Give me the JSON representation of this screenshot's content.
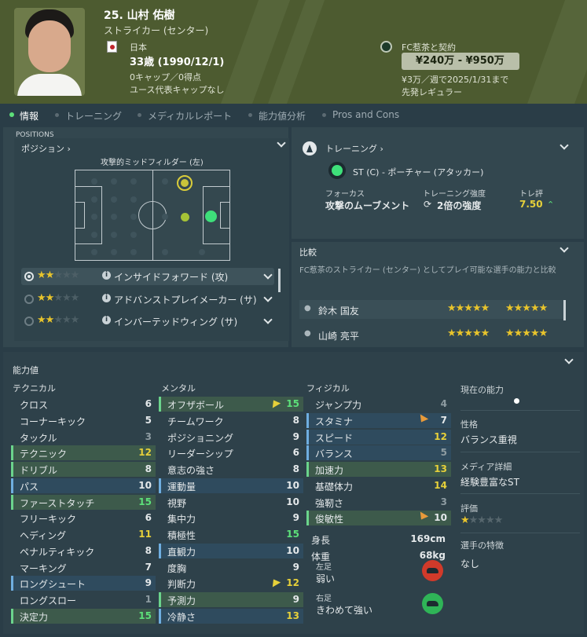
{
  "header": {
    "name": "25. 山村 佑樹",
    "position": "ストライカー (センター)",
    "nation": "日本",
    "age": "33歳 (1990/12/1)",
    "caps": "0キャップ／0得点",
    "youth_caps": "ユース代表キャップなし",
    "club_contract": "FC惹茶と契約",
    "value_range": "¥240万 - ¥950万",
    "wage": "¥3万／週で2025/1/31まで",
    "squad_status": "先発レギュラー"
  },
  "tabs": [
    "情報",
    "トレーニング",
    "メディカルレポート",
    "能力値分析",
    "Pros and Cons"
  ],
  "positions": {
    "section": "POSITIONS",
    "title": "ポジション",
    "pitch_label": "攻撃的ミッドフィルダー (左)",
    "roles": [
      {
        "label": "インサイドフォワード (攻)",
        "stars": 2,
        "selected": true
      },
      {
        "label": "アドバンストプレイメーカー (サ)",
        "stars": 2,
        "selected": false
      },
      {
        "label": "インバーテッドウィング (サ)",
        "stars": 2,
        "selected": false
      }
    ]
  },
  "training": {
    "title": "トレーニング",
    "role": "ST (C) - ポーチャー (アタッカー)",
    "focus_label": "フォーカス",
    "focus": "攻撃のムーブメント",
    "intensity_label": "トレーニング強度",
    "intensity": "2倍の強度",
    "rating_label": "トレ評",
    "rating": "7.50"
  },
  "comparison": {
    "title": "比較",
    "desc": "FC惹茶のストライカー (センター) としてプレイ可能な選手の能力と比較",
    "players": [
      {
        "name": "鈴木 国友",
        "cur_stars": 4.5,
        "pot_stars": 4.5
      },
      {
        "name": "山崎 亮平",
        "cur_stars": 4.5,
        "pot_stars": 4.5
      }
    ]
  },
  "attributes": {
    "title": "能力値",
    "technical_title": "テクニカル",
    "mental_title": "メンタル",
    "physical_title": "フィジカル",
    "technical": [
      {
        "n": "クロス",
        "v": "6",
        "c": "w",
        "h": ""
      },
      {
        "n": "コーナーキック",
        "v": "5",
        "c": "w",
        "h": ""
      },
      {
        "n": "タックル",
        "v": "3",
        "c": "d",
        "h": ""
      },
      {
        "n": "テクニック",
        "v": "12",
        "c": "y",
        "h": "g"
      },
      {
        "n": "ドリブル",
        "v": "8",
        "c": "w",
        "h": "g"
      },
      {
        "n": "パス",
        "v": "10",
        "c": "w",
        "h": "b"
      },
      {
        "n": "ファーストタッチ",
        "v": "15",
        "c": "g",
        "h": "g"
      },
      {
        "n": "フリーキック",
        "v": "6",
        "c": "w",
        "h": ""
      },
      {
        "n": "ヘディング",
        "v": "11",
        "c": "y",
        "h": ""
      },
      {
        "n": "ペナルティキック",
        "v": "8",
        "c": "w",
        "h": ""
      },
      {
        "n": "マーキング",
        "v": "7",
        "c": "w",
        "h": ""
      },
      {
        "n": "ロングシュート",
        "v": "9",
        "c": "w",
        "h": "b"
      },
      {
        "n": "ロングスロー",
        "v": "1",
        "c": "d",
        "h": ""
      },
      {
        "n": "決定力",
        "v": "15",
        "c": "g",
        "h": "g"
      }
    ],
    "mental": [
      {
        "n": "オフザボール",
        "v": "15",
        "c": "g",
        "h": "g",
        "a": "up"
      },
      {
        "n": "チームワーク",
        "v": "8",
        "c": "w",
        "h": ""
      },
      {
        "n": "ポジショニング",
        "v": "9",
        "c": "w",
        "h": ""
      },
      {
        "n": "リーダーシップ",
        "v": "6",
        "c": "w",
        "h": ""
      },
      {
        "n": "意志の強さ",
        "v": "8",
        "c": "w",
        "h": ""
      },
      {
        "n": "運動量",
        "v": "10",
        "c": "w",
        "h": "b"
      },
      {
        "n": "視野",
        "v": "10",
        "c": "w",
        "h": ""
      },
      {
        "n": "集中力",
        "v": "9",
        "c": "w",
        "h": ""
      },
      {
        "n": "積極性",
        "v": "15",
        "c": "g",
        "h": ""
      },
      {
        "n": "直観力",
        "v": "10",
        "c": "w",
        "h": "b"
      },
      {
        "n": "度胸",
        "v": "9",
        "c": "w",
        "h": ""
      },
      {
        "n": "判断力",
        "v": "12",
        "c": "y",
        "h": "",
        "a": "up"
      },
      {
        "n": "予測力",
        "v": "9",
        "c": "w",
        "h": "g"
      },
      {
        "n": "冷静さ",
        "v": "13",
        "c": "y",
        "h": "b"
      }
    ],
    "physical": [
      {
        "n": "ジャンプ力",
        "v": "4",
        "c": "d",
        "h": ""
      },
      {
        "n": "スタミナ",
        "v": "7",
        "c": "w",
        "h": "b",
        "a": "down"
      },
      {
        "n": "スピード",
        "v": "12",
        "c": "y",
        "h": "b"
      },
      {
        "n": "バランス",
        "v": "5",
        "c": "d",
        "h": "b"
      },
      {
        "n": "加速力",
        "v": "13",
        "c": "y",
        "h": "g"
      },
      {
        "n": "基礎体力",
        "v": "14",
        "c": "y",
        "h": ""
      },
      {
        "n": "強靭さ",
        "v": "3",
        "c": "d",
        "h": ""
      },
      {
        "n": "俊敏性",
        "v": "10",
        "c": "w",
        "h": "g",
        "a": "down"
      }
    ],
    "height_label": "身長",
    "height": "169cm",
    "weight_label": "体重",
    "weight": "68kg",
    "left_foot_label": "左足",
    "left_foot": "弱い",
    "right_foot_label": "右足",
    "right_foot": "きわめて強い"
  },
  "side": {
    "current_ability": "現在の能力",
    "personality_label": "性格",
    "personality": "バランス重視",
    "media_label": "メディア詳細",
    "media": "経験豊富なST",
    "rating_label": "評価",
    "traits_label": "選手の特徴",
    "traits": "なし"
  }
}
